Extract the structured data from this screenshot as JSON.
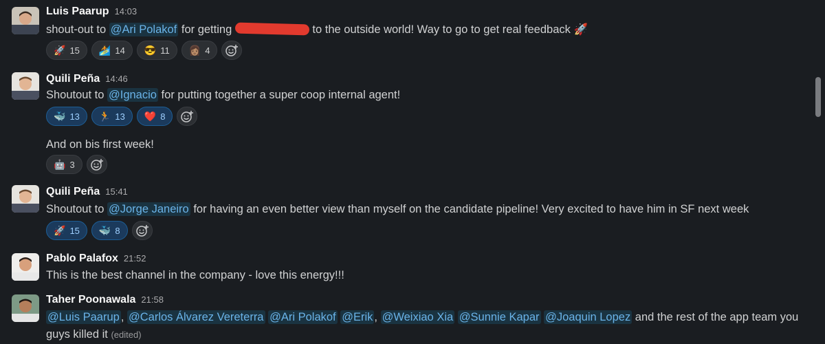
{
  "messages": [
    {
      "author": "Luis Paarup",
      "time": "14:03",
      "text_pre": "shout-out to ",
      "mention": "@Ari Polakof",
      "text_mid": " for getting ",
      "text_post": " to the outside world! Way to go to get real feedback 🚀",
      "reactions": [
        {
          "emoji": "🚀",
          "count": "15"
        },
        {
          "emoji": "🏄",
          "count": "14"
        },
        {
          "emoji": "😎",
          "count": "11"
        },
        {
          "emoji": "👩🏽",
          "count": "4"
        }
      ]
    },
    {
      "author": "Quili Peña",
      "time": "14:46",
      "text_pre": "Shoutout to ",
      "mention": "@Ignacio",
      "text_post": " for putting together a super coop internal agent!",
      "reactions": [
        {
          "emoji": "🐳",
          "count": "13"
        },
        {
          "emoji": "🏃",
          "count": "13"
        },
        {
          "emoji": "❤️",
          "count": "8"
        }
      ],
      "followup": "And on bis first week!",
      "followup_reactions": [
        {
          "emoji": "🤖",
          "count": "3"
        }
      ]
    },
    {
      "author": "Quili Peña",
      "time": "15:41",
      "text_pre": "Shoutout to ",
      "mention": "@Jorge Janeiro",
      "text_post": " for having an even better view than myself on the candidate pipeline! Very excited to have him in SF next week",
      "reactions": [
        {
          "emoji": "🚀",
          "count": "15"
        },
        {
          "emoji": "🐳",
          "count": "8"
        }
      ]
    },
    {
      "author": "Pablo Palafox",
      "time": "21:52",
      "text": "This is the best channel in the company - love this energy!!!"
    },
    {
      "author": "Taher Poonawala",
      "time": "21:58",
      "mentions": [
        "@Luis Paarup",
        "@Carlos Álvarez Vereterra",
        "@Ari Polakof",
        "@Erik",
        "@Weixiao Xia",
        "@Sunnie Kapar",
        "@Joaquin Lopez"
      ],
      "sep": ",",
      "text_post": " and the rest of the app team you",
      "text_line2": "guys killed it",
      "edited": "(edited)"
    }
  ],
  "icons": {
    "add_reaction": "add-reaction-icon"
  },
  "colors": {
    "background": "#1a1d21",
    "mention": "#6ab3e8",
    "active_reaction": "#1b3a5c",
    "redaction": "#e23a2e"
  }
}
